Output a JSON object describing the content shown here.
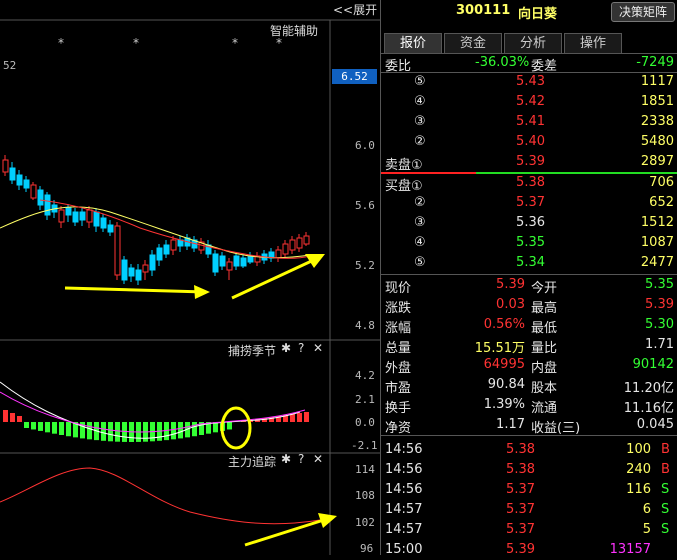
{
  "chart": {
    "top_controls": {
      "expand": "<<展开",
      "assist": "智能辅助"
    },
    "price_label": "52",
    "current_price_tag": "6.52",
    "price_axis": [
      "6.0",
      "5.6",
      "5.2",
      "4.8"
    ],
    "indicator1": {
      "name": "捕捞季节",
      "axis": [
        "4.2",
        "2.1",
        "0.0",
        "-2.1"
      ]
    },
    "indicator2": {
      "name": "主力追踪",
      "axis": [
        "114",
        "108",
        "102",
        "96"
      ]
    },
    "ctrl_icons": {
      "gear": "✱",
      "help": "?",
      "close": "✕"
    }
  },
  "stock": {
    "code": "300111",
    "name": "向日葵",
    "button": "决策矩阵"
  },
  "tabs": [
    "报价",
    "资金",
    "分析",
    "操作"
  ],
  "weibi": {
    "label1": "委比",
    "val1": "-36.03%",
    "label2": "委差",
    "val2": "-7249"
  },
  "sell_book": [
    {
      "idx": "⑤",
      "price": "5.43",
      "vol": "1117"
    },
    {
      "idx": "④",
      "price": "5.42",
      "vol": "1851"
    },
    {
      "idx": "③",
      "price": "5.41",
      "vol": "2338"
    },
    {
      "idx": "②",
      "price": "5.40",
      "vol": "5480"
    },
    {
      "idx": "卖盘①",
      "price": "5.39",
      "vol": "2897"
    }
  ],
  "buy_book": [
    {
      "idx": "买盘①",
      "price": "5.38",
      "vol": "706"
    },
    {
      "idx": "②",
      "price": "5.37",
      "vol": "652"
    },
    {
      "idx": "③",
      "price": "5.36",
      "vol": "1512"
    },
    {
      "idx": "④",
      "price": "5.35",
      "vol": "1087"
    },
    {
      "idx": "⑤",
      "price": "5.34",
      "vol": "2477"
    }
  ],
  "stats": [
    {
      "l1": "现价",
      "v1": "5.39",
      "l2": "今开",
      "v2": "5.35"
    },
    {
      "l1": "涨跌",
      "v1": "0.03",
      "l2": "最高",
      "v2": "5.39"
    },
    {
      "l1": "涨幅",
      "v1": "0.56%",
      "l2": "最低",
      "v2": "5.30"
    },
    {
      "l1": "总量",
      "v1": "15.51万",
      "l2": "量比",
      "v2": "1.71"
    },
    {
      "l1": "外盘",
      "v1": "64995",
      "l2": "内盘",
      "v2": "90142"
    },
    {
      "l1": "市盈",
      "v1": "90.84",
      "l2": "股本",
      "v2": "11.20亿"
    },
    {
      "l1": "换手",
      "v1": "1.39%",
      "l2": "流通",
      "v2": "11.16亿"
    },
    {
      "l1": "净资",
      "v1": "1.17",
      "l2": "收益(三)",
      "v2": "0.045"
    }
  ],
  "ticks": [
    {
      "time": "14:56",
      "price": "5.38",
      "vol": "100",
      "side": "B"
    },
    {
      "time": "14:56",
      "price": "5.38",
      "vol": "240",
      "side": "B"
    },
    {
      "time": "14:56",
      "price": "5.37",
      "vol": "116",
      "side": "S"
    },
    {
      "time": "14:57",
      "price": "5.37",
      "vol": "6",
      "side": "S"
    },
    {
      "time": "14:57",
      "price": "5.37",
      "vol": "5",
      "side": "S"
    },
    {
      "time": "15:00",
      "price": "5.39",
      "vol": "13157",
      "side": ""
    }
  ],
  "colors": {
    "up": "#ff3333",
    "down": "#33ff33",
    "neutral": "#e6e6e6",
    "highlight": "#ffff00"
  }
}
